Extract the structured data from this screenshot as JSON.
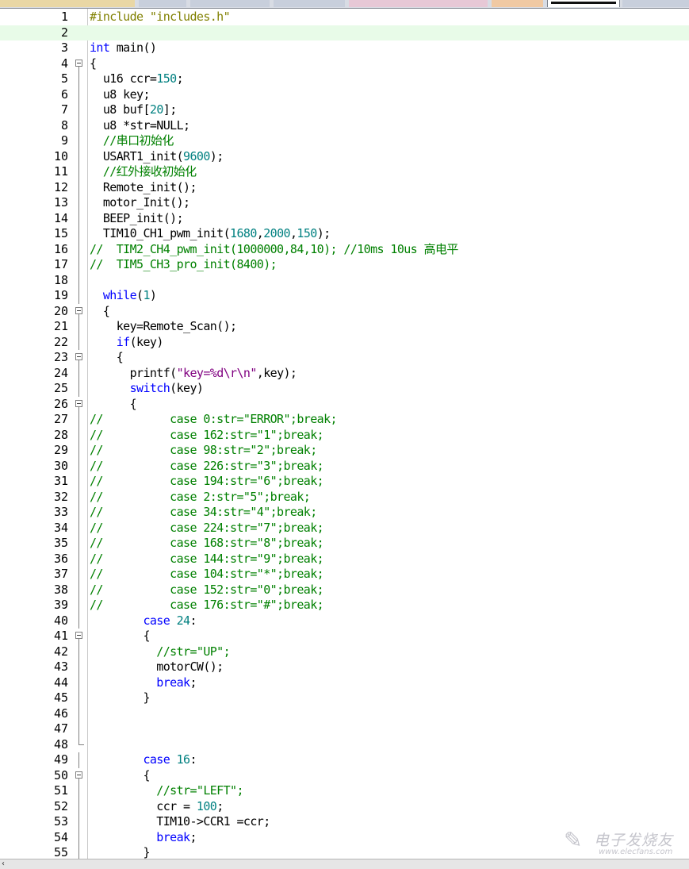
{
  "editor": {
    "current_line": 2,
    "fold_markers": {
      "4": "box",
      "5": "line",
      "6": "line",
      "7": "line",
      "8": "line",
      "9": "line",
      "10": "line",
      "11": "line",
      "12": "line",
      "13": "line",
      "14": "line",
      "15": "line",
      "16": "line",
      "17": "line",
      "18": "line",
      "19": "line",
      "20": "box",
      "21": "line",
      "22": "line",
      "23": "box",
      "24": "line",
      "25": "line",
      "26": "box",
      "27": "line",
      "28": "line",
      "29": "line",
      "30": "line",
      "31": "line",
      "32": "line",
      "33": "line",
      "34": "line",
      "35": "line",
      "36": "line",
      "37": "line",
      "38": "line",
      "39": "line",
      "40": "line",
      "41": "box",
      "42": "line",
      "43": "line",
      "44": "line",
      "45": "line",
      "46": "line",
      "47": "line",
      "48": "end",
      "49": "line",
      "50": "box",
      "51": "line",
      "52": "line",
      "53": "line",
      "54": "line",
      "55": "line"
    },
    "lines": [
      {
        "n": "1",
        "tokens": [
          [
            "pp",
            "#include \"includes.h\""
          ]
        ]
      },
      {
        "n": "2",
        "tokens": []
      },
      {
        "n": "3",
        "tokens": [
          [
            "kw",
            "int"
          ],
          [
            "nm",
            " main()"
          ]
        ]
      },
      {
        "n": "4",
        "tokens": [
          [
            "nm",
            "{"
          ]
        ]
      },
      {
        "n": "5",
        "tokens": [
          [
            "nm",
            "  u16 ccr="
          ],
          [
            "num",
            "150"
          ],
          [
            "nm",
            ";"
          ]
        ]
      },
      {
        "n": "6",
        "tokens": [
          [
            "nm",
            "  u8 key;"
          ]
        ]
      },
      {
        "n": "7",
        "tokens": [
          [
            "nm",
            "  u8 buf["
          ],
          [
            "num",
            "20"
          ],
          [
            "nm",
            "];"
          ]
        ]
      },
      {
        "n": "8",
        "tokens": [
          [
            "nm",
            "  u8 *str=NULL;"
          ]
        ]
      },
      {
        "n": "9",
        "tokens": [
          [
            "cm",
            "  //串口初始化"
          ]
        ]
      },
      {
        "n": "10",
        "tokens": [
          [
            "nm",
            "  USART1_init("
          ],
          [
            "num",
            "9600"
          ],
          [
            "nm",
            ");"
          ]
        ]
      },
      {
        "n": "11",
        "tokens": [
          [
            "cm",
            "  //红外接收初始化"
          ]
        ]
      },
      {
        "n": "12",
        "tokens": [
          [
            "nm",
            "  Remote_init();"
          ]
        ]
      },
      {
        "n": "13",
        "tokens": [
          [
            "nm",
            "  motor_Init();"
          ]
        ]
      },
      {
        "n": "14",
        "tokens": [
          [
            "nm",
            "  BEEP_init();"
          ]
        ]
      },
      {
        "n": "15",
        "tokens": [
          [
            "nm",
            "  TIM10_CH1_pwm_init("
          ],
          [
            "num",
            "1680"
          ],
          [
            "nm",
            ","
          ],
          [
            "num",
            "2000"
          ],
          [
            "nm",
            ","
          ],
          [
            "num",
            "150"
          ],
          [
            "nm",
            ");"
          ]
        ]
      },
      {
        "n": "16",
        "tokens": [
          [
            "cm",
            "//  TIM2_CH4_pwm_init(1000000,84,10); //10ms 10us 高电平"
          ]
        ]
      },
      {
        "n": "17",
        "tokens": [
          [
            "cm",
            "//  TIM5_CH3_pro_init(8400);"
          ]
        ]
      },
      {
        "n": "18",
        "tokens": []
      },
      {
        "n": "19",
        "tokens": [
          [
            "kw",
            "  while"
          ],
          [
            "nm",
            "("
          ],
          [
            "num",
            "1"
          ],
          [
            "nm",
            ")"
          ]
        ]
      },
      {
        "n": "20",
        "tokens": [
          [
            "nm",
            "  {"
          ]
        ]
      },
      {
        "n": "21",
        "tokens": [
          [
            "nm",
            "    key=Remote_Scan();"
          ]
        ]
      },
      {
        "n": "22",
        "tokens": [
          [
            "kw",
            "    if"
          ],
          [
            "nm",
            "(key)"
          ]
        ]
      },
      {
        "n": "23",
        "tokens": [
          [
            "nm",
            "    {"
          ]
        ]
      },
      {
        "n": "24",
        "tokens": [
          [
            "nm",
            "      printf("
          ],
          [
            "str",
            "\"key=%d\\r\\n\""
          ],
          [
            "nm",
            ",key);"
          ]
        ]
      },
      {
        "n": "25",
        "tokens": [
          [
            "kw",
            "      switch"
          ],
          [
            "nm",
            "(key)"
          ]
        ]
      },
      {
        "n": "26",
        "tokens": [
          [
            "nm",
            "      {"
          ]
        ]
      },
      {
        "n": "27",
        "tokens": [
          [
            "cm",
            "//          case 0:str=\"ERROR\";break;"
          ]
        ]
      },
      {
        "n": "28",
        "tokens": [
          [
            "cm",
            "//          case 162:str=\"1\";break;"
          ]
        ]
      },
      {
        "n": "29",
        "tokens": [
          [
            "cm",
            "//          case 98:str=\"2\";break;"
          ]
        ]
      },
      {
        "n": "30",
        "tokens": [
          [
            "cm",
            "//          case 226:str=\"3\";break;"
          ]
        ]
      },
      {
        "n": "31",
        "tokens": [
          [
            "cm",
            "//          case 194:str=\"6\";break;"
          ]
        ]
      },
      {
        "n": "32",
        "tokens": [
          [
            "cm",
            "//          case 2:str=\"5\";break;"
          ]
        ]
      },
      {
        "n": "33",
        "tokens": [
          [
            "cm",
            "//          case 34:str=\"4\";break;"
          ]
        ]
      },
      {
        "n": "34",
        "tokens": [
          [
            "cm",
            "//          case 224:str=\"7\";break;"
          ]
        ]
      },
      {
        "n": "35",
        "tokens": [
          [
            "cm",
            "//          case 168:str=\"8\";break;"
          ]
        ]
      },
      {
        "n": "36",
        "tokens": [
          [
            "cm",
            "//          case 144:str=\"9\";break;"
          ]
        ]
      },
      {
        "n": "37",
        "tokens": [
          [
            "cm",
            "//          case 104:str=\"*\";break;"
          ]
        ]
      },
      {
        "n": "38",
        "tokens": [
          [
            "cm",
            "//          case 152:str=\"0\";break;"
          ]
        ]
      },
      {
        "n": "39",
        "tokens": [
          [
            "cm",
            "//          case 176:str=\"#\";break;"
          ]
        ]
      },
      {
        "n": "40",
        "tokens": [
          [
            "kw",
            "        case"
          ],
          [
            "nm",
            " "
          ],
          [
            "num",
            "24"
          ],
          [
            "nm",
            ":"
          ]
        ]
      },
      {
        "n": "41",
        "tokens": [
          [
            "nm",
            "        {"
          ]
        ]
      },
      {
        "n": "42",
        "tokens": [
          [
            "cm",
            "          //str=\"UP\";"
          ]
        ]
      },
      {
        "n": "43",
        "tokens": [
          [
            "nm",
            "          motorCW();"
          ]
        ]
      },
      {
        "n": "44",
        "tokens": [
          [
            "kw",
            "          break"
          ],
          [
            "nm",
            ";"
          ]
        ]
      },
      {
        "n": "45",
        "tokens": [
          [
            "nm",
            "        }"
          ]
        ]
      },
      {
        "n": "46",
        "tokens": []
      },
      {
        "n": "47",
        "tokens": []
      },
      {
        "n": "48",
        "tokens": []
      },
      {
        "n": "49",
        "tokens": [
          [
            "kw",
            "        case"
          ],
          [
            "nm",
            " "
          ],
          [
            "num",
            "16"
          ],
          [
            "nm",
            ":"
          ]
        ]
      },
      {
        "n": "50",
        "tokens": [
          [
            "nm",
            "        {"
          ]
        ]
      },
      {
        "n": "51",
        "tokens": [
          [
            "cm",
            "          //str=\"LEFT\";"
          ]
        ]
      },
      {
        "n": "52",
        "tokens": [
          [
            "nm",
            "          ccr = "
          ],
          [
            "num",
            "100"
          ],
          [
            "nm",
            ";"
          ]
        ]
      },
      {
        "n": "53",
        "tokens": [
          [
            "nm",
            "          TIM10->CCR1 =ccr;"
          ]
        ]
      },
      {
        "n": "54",
        "tokens": [
          [
            "kw",
            "          break"
          ],
          [
            "nm",
            ";"
          ]
        ]
      },
      {
        "n": "55",
        "tokens": [
          [
            "nm",
            "        }"
          ]
        ]
      }
    ]
  },
  "tabs": [
    {
      "color": "#e9d7a5"
    },
    {
      "color": "#c8cfdc"
    },
    {
      "color": "#c8cfdc"
    },
    {
      "color": "#c8cfdc"
    },
    {
      "color": "#e7c8d6"
    },
    {
      "color": "#f0c9a3"
    },
    {
      "color": "#ffffff",
      "active": true
    },
    {
      "color": "#c8cfdc"
    }
  ],
  "colors": {
    "preprocessor": "#808000",
    "keyword": "#0000ff",
    "number": "#008080",
    "string": "#800080",
    "comment": "#008000",
    "current_line_bg": "#e8fbe8"
  },
  "scrollbar": {
    "left_arrow": "‹"
  },
  "watermark": {
    "logo": "✎",
    "cn": "电子发烧友",
    "url": "www.elecfans.com"
  }
}
